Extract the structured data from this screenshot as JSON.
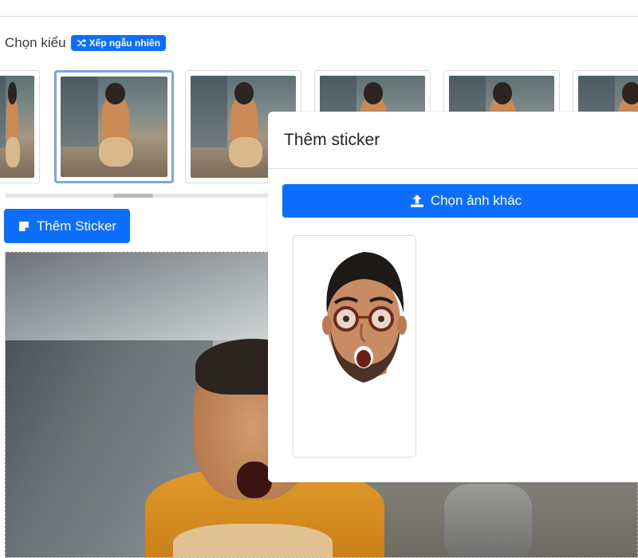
{
  "page": {
    "style_label": "Chọn kiểu",
    "shuffle_label": "Xếp ngẫu nhiên",
    "add_sticker_label": "Thêm Sticker",
    "thumbnails": [
      {
        "selected": false
      },
      {
        "selected": true
      },
      {
        "selected": false
      },
      {
        "selected": false
      },
      {
        "selected": false
      },
      {
        "selected": false
      }
    ]
  },
  "modal": {
    "title": "Thêm sticker",
    "choose_image_label": "Chọn ảnh khác"
  },
  "colors": {
    "primary": "#0d6efd",
    "selected_border": "#7fa6d6"
  },
  "icons": {
    "shuffle": "shuffle-icon",
    "sticker": "sticker-icon",
    "upload": "upload-icon"
  }
}
